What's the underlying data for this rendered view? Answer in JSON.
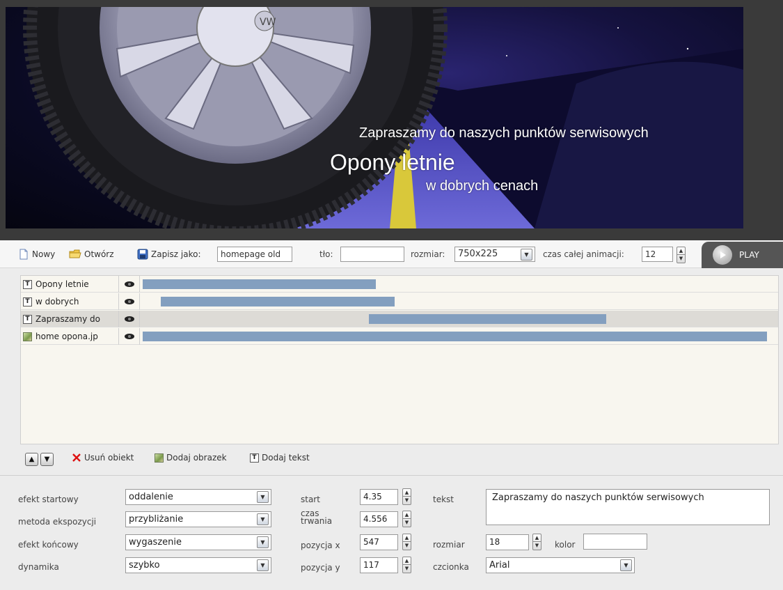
{
  "banner": {
    "line1": "Zapraszamy do naszych punktów serwisowych",
    "line2": "Opony letnie",
    "line3": "w dobrych cenach"
  },
  "toolbar": {
    "new_label": "Nowy",
    "open_label": "Otwórz",
    "save_as_label": "Zapisz jako:",
    "save_as_value": "homepage  old",
    "bg_label": "tło:",
    "bg_value": "",
    "size_label": "rozmiar:",
    "size_value": "750x225",
    "duration_label": "czas całej animacji:",
    "duration_value": "12",
    "play_label": "PLAY"
  },
  "timeline": {
    "rows": [
      {
        "name": "Opony letnie",
        "icon": "text-object-icon"
      },
      {
        "name": "w dobrych",
        "icon": "text-object-icon"
      },
      {
        "name": "Zapraszamy do",
        "icon": "text-object-icon"
      },
      {
        "name": "home  opona.jp",
        "icon": "image-object-icon"
      }
    ]
  },
  "objbar": {
    "remove_label": "Usuń obiekt",
    "add_image_label": "Dodaj obrazek",
    "add_text_label": "Dodaj tekst"
  },
  "props": {
    "start_effect_label": "efekt startowy",
    "start_effect_value": "oddalenie",
    "exposure_label": "metoda ekspozycji",
    "exposure_value": "przybliżanie",
    "end_effect_label": "efekt końcowy",
    "end_effect_value": "wygaszenie",
    "dynamics_label": "dynamika",
    "dynamics_value": "szybko",
    "start_label": "start",
    "start_value": "4.35",
    "duration_label_1": "czas",
    "duration_label_2": "trwania",
    "duration_value": "4.556",
    "pos_x_label": "pozycja x",
    "pos_x_value": "547",
    "pos_y_label": "pozycja y",
    "pos_y_value": "117",
    "text_label": "tekst",
    "text_value": "Zapraszamy do naszych punktów serwisowych",
    "size_label": "rozmiar",
    "size_value": "18",
    "color_label": "kolor",
    "color_value": "",
    "font_label": "czcionka",
    "font_value": "Arial"
  }
}
